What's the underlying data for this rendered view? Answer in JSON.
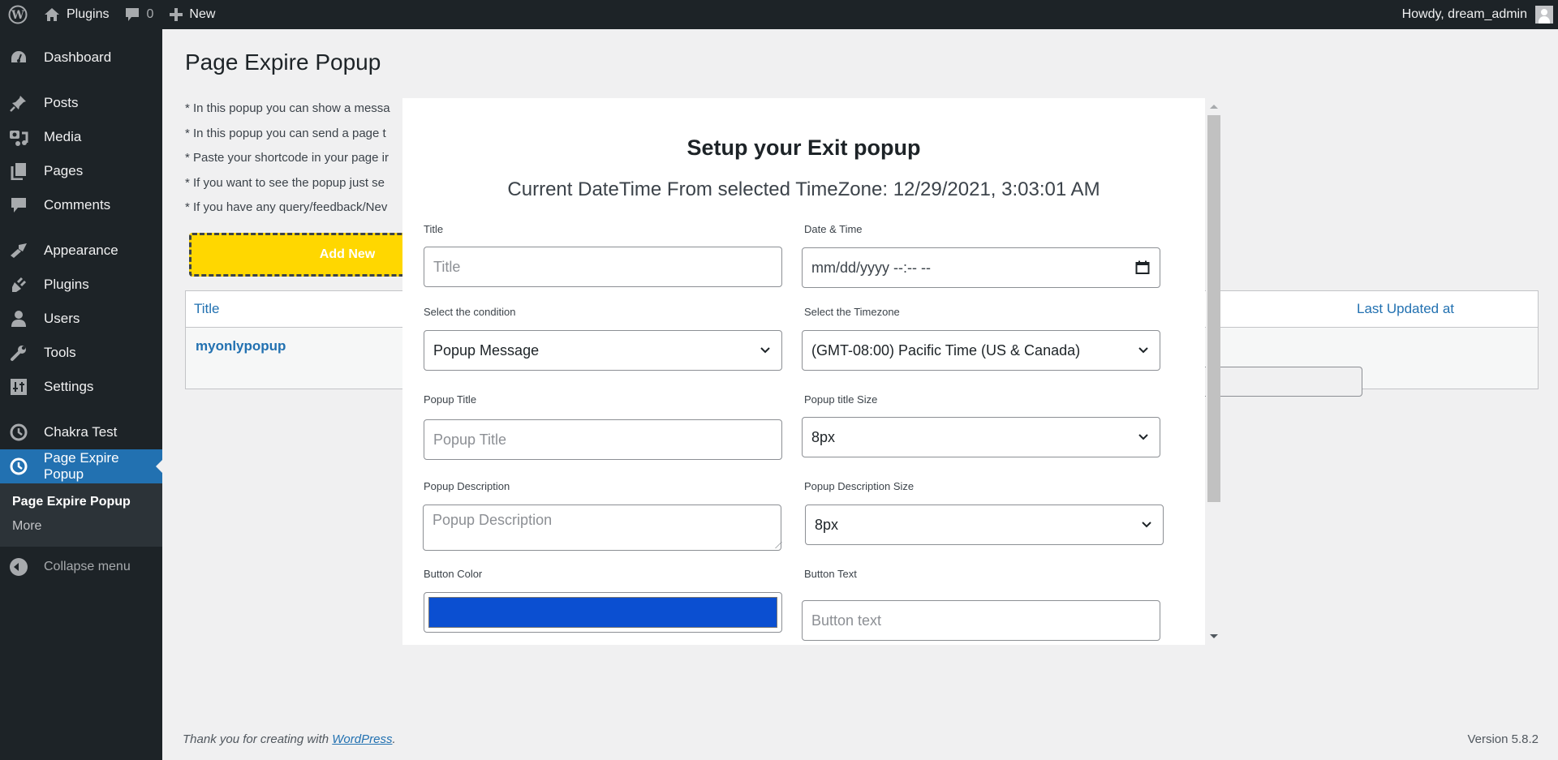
{
  "adminbar": {
    "site_link": "Plugins",
    "comments_count": "0",
    "new_label": "New",
    "greeting": "Howdy, dream_admin"
  },
  "sidebar": {
    "items": [
      {
        "label": "Dashboard",
        "icon": "dashboard-icon"
      },
      {
        "label": "Posts",
        "icon": "pin-icon"
      },
      {
        "label": "Media",
        "icon": "media-icon"
      },
      {
        "label": "Pages",
        "icon": "pages-icon"
      },
      {
        "label": "Comments",
        "icon": "comment-icon"
      },
      {
        "label": "Appearance",
        "icon": "paintbrush-icon"
      },
      {
        "label": "Plugins",
        "icon": "plugin-icon"
      },
      {
        "label": "Users",
        "icon": "user-icon"
      },
      {
        "label": "Tools",
        "icon": "wrench-icon"
      },
      {
        "label": "Settings",
        "icon": "settings-icon"
      },
      {
        "label": "Chakra Test",
        "icon": "clock-icon"
      },
      {
        "label": "Page Expire Popup",
        "icon": "clock-icon",
        "active": true
      }
    ],
    "submenu": [
      "Page Expire Popup",
      "More"
    ],
    "collapse_label": "Collapse menu"
  },
  "page": {
    "title": "Page Expire Popup",
    "notes": [
      "* In this popup you can show a messa",
      "* In this popup you can send a page t",
      "* Paste your shortcode in your page ir",
      "* If you want to see the popup just se",
      "* If you have any query/feedback/Nev"
    ],
    "add_new_label": "Add New",
    "accent_color": "#ffd700",
    "table": {
      "columns": [
        "Title",
        "Last Updated at"
      ],
      "rows": [
        {
          "title": "myonlypopup"
        }
      ]
    }
  },
  "modal": {
    "title": "Setup your Exit popup",
    "datetime_text": "Current DateTime From selected TimeZone: 12/29/2021, 3:03:01 AM",
    "fields": {
      "title": {
        "label": "Title",
        "placeholder": "Title"
      },
      "datetime": {
        "label": "Date & Time",
        "placeholder": "mm/dd/yyyy --:-- --"
      },
      "condition": {
        "label": "Select the condition",
        "value": "Popup Message"
      },
      "timezone": {
        "label": "Select the Timezone",
        "value": "(GMT-08:00) Pacific Time (US & Canada)"
      },
      "popup_title": {
        "label": "Popup Title",
        "placeholder": "Popup Title"
      },
      "popup_title_size": {
        "label": "Popup title Size",
        "value": "8px"
      },
      "popup_description": {
        "label": "Popup Description",
        "placeholder": "Popup Description"
      },
      "popup_description_size": {
        "label": "Popup Description Size",
        "value": "8px"
      },
      "button_color": {
        "label": "Button Color",
        "value": "#0b4fd1"
      },
      "button_text": {
        "label": "Button Text",
        "placeholder": "Button text"
      }
    }
  },
  "footer": {
    "thanks_prefix": "Thank you for creating with ",
    "thanks_link": "WordPress",
    "thanks_suffix": ".",
    "version": "Version 5.8.2"
  }
}
